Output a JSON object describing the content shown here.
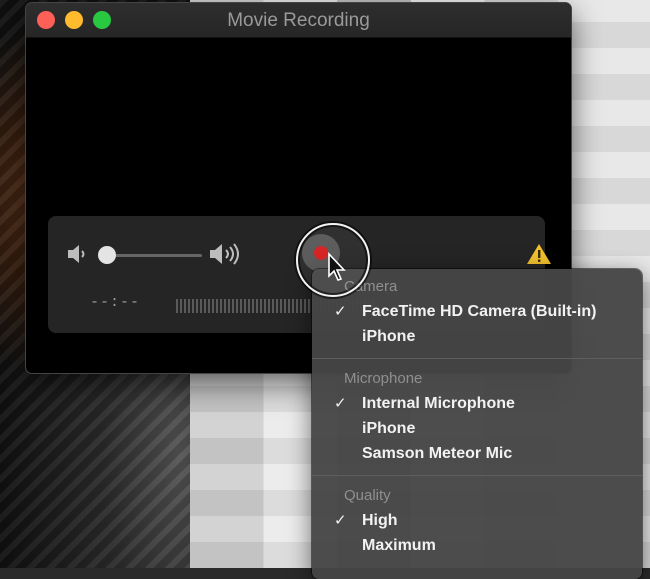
{
  "window": {
    "title": "Movie Recording"
  },
  "controls": {
    "volume_low_icon": "speaker-low-icon",
    "volume_high_icon": "speaker-high-icon",
    "volume_level": 0.0,
    "record_icon": "record-icon",
    "warning_icon": "warning-icon",
    "time_display": "--:--"
  },
  "menu": {
    "camera": {
      "header": "Camera",
      "items": [
        {
          "label": "FaceTime HD Camera (Built-in)",
          "checked": true
        },
        {
          "label": "iPhone",
          "checked": false
        }
      ]
    },
    "microphone": {
      "header": "Microphone",
      "items": [
        {
          "label": "Internal Microphone",
          "checked": true
        },
        {
          "label": "iPhone",
          "checked": false
        },
        {
          "label": "Samson Meteor Mic",
          "checked": false
        }
      ]
    },
    "quality": {
      "header": "Quality",
      "items": [
        {
          "label": "High",
          "checked": true
        },
        {
          "label": "Maximum",
          "checked": false
        }
      ]
    },
    "check_mark": "✓"
  },
  "colors": {
    "close": "#fe5f57",
    "minimize": "#febb2e",
    "maximize": "#28c840",
    "record": "#d61a1a",
    "warning": "#f2c12e"
  }
}
